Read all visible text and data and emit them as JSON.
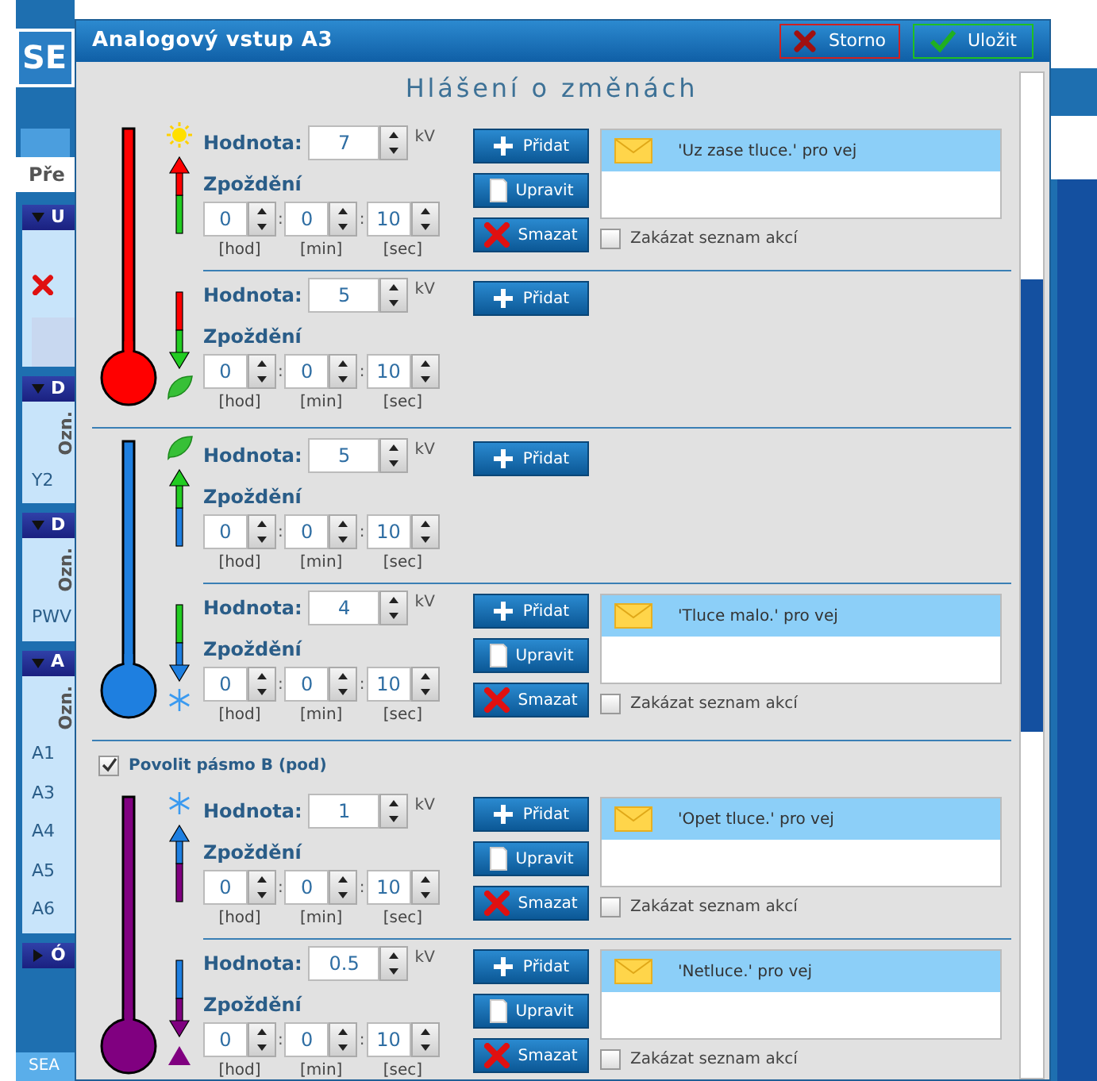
{
  "background_app": {
    "logo": "SE",
    "tab_label": "Pře",
    "panels": [
      {
        "header": "U",
        "expanded": true,
        "kind": "status"
      },
      {
        "header": "D",
        "expanded": true,
        "kind": "table",
        "column": "Ozn.",
        "rows": [
          "Y2"
        ]
      },
      {
        "header": "D",
        "expanded": true,
        "kind": "table",
        "column": "Ozn.",
        "rows": [
          "PWV"
        ]
      },
      {
        "header": "A",
        "expanded": true,
        "kind": "table",
        "column": "Ozn.",
        "rows": [
          "A1",
          "A3",
          "A4",
          "A5",
          "A6"
        ]
      },
      {
        "header": "Ó",
        "expanded": false
      }
    ],
    "footer": "SEA"
  },
  "dialog": {
    "title": "Analogový vstup A3",
    "buttons": [
      {
        "label": "Storno",
        "kind": "cancel"
      },
      {
        "label": "Uložit",
        "kind": "save"
      }
    ],
    "heading": "Hlášení o změnách"
  },
  "bands": [
    {
      "color": "#ff0000",
      "thresholds": [
        {
          "kind": "sun",
          "arrow": {
            "kind": "up",
            "segments": [
              {
                "color": "#22cc22"
              },
              {
                "color": "#ff0000"
              }
            ]
          },
          "value_label": "Hodnota:",
          "value": "7",
          "unit": "kV",
          "delay": {
            "label": "Zpoždění",
            "separator": ":",
            "fields": [
              {
                "value": "0",
                "unit": "[hod]"
              },
              {
                "value": "0",
                "unit": "[min]"
              },
              {
                "value": "10",
                "unit": "[sec]"
              }
            ]
          },
          "buttons": [
            {
              "label": "Přidat",
              "kind": "add"
            },
            {
              "label": "Upravit",
              "kind": "edit"
            },
            {
              "label": "Smazat",
              "kind": "delete"
            }
          ],
          "actions": [
            {
              "text": "'Uz zase tluce.' pro vej",
              "selected": true
            }
          ],
          "disable_actions": {
            "label": "Zakázat seznam akcí",
            "checked": false
          }
        },
        {
          "kind": "leaf",
          "arrow": {
            "kind": "down",
            "segments": [
              {
                "color": "#ff0000"
              },
              {
                "color": "#22cc22"
              }
            ]
          },
          "value_label": "Hodnota:",
          "value": "5",
          "unit": "kV",
          "delay": {
            "label": "Zpoždění",
            "separator": ":",
            "fields": [
              {
                "value": "0",
                "unit": "[hod]"
              },
              {
                "value": "0",
                "unit": "[min]"
              },
              {
                "value": "10",
                "unit": "[sec]"
              }
            ]
          },
          "buttons": [
            {
              "label": "Přidat",
              "kind": "add"
            }
          ]
        }
      ]
    },
    {
      "color": "#1e7fe0",
      "thresholds": [
        {
          "kind": "leaf",
          "arrow": {
            "kind": "up",
            "segments": [
              {
                "color": "#1e7fe0"
              },
              {
                "color": "#22cc22"
              }
            ]
          },
          "value_label": "Hodnota:",
          "value": "5",
          "unit": "kV",
          "delay": {
            "label": "Zpoždění",
            "separator": ":",
            "fields": [
              {
                "value": "0",
                "unit": "[hod]"
              },
              {
                "value": "0",
                "unit": "[min]"
              },
              {
                "value": "10",
                "unit": "[sec]"
              }
            ]
          },
          "buttons": [
            {
              "label": "Přidat",
              "kind": "add"
            }
          ]
        },
        {
          "kind": "snowflake",
          "arrow": {
            "kind": "down",
            "segments": [
              {
                "color": "#22cc22"
              },
              {
                "color": "#1e7fe0"
              }
            ]
          },
          "value_label": "Hodnota:",
          "value": "4",
          "unit": "kV",
          "delay": {
            "label": "Zpoždění",
            "separator": ":",
            "fields": [
              {
                "value": "0",
                "unit": "[hod]"
              },
              {
                "value": "0",
                "unit": "[min]"
              },
              {
                "value": "10",
                "unit": "[sec]"
              }
            ]
          },
          "buttons": [
            {
              "label": "Přidat",
              "kind": "add"
            },
            {
              "label": "Upravit",
              "kind": "edit"
            },
            {
              "label": "Smazat",
              "kind": "delete"
            }
          ],
          "actions": [
            {
              "text": "'Tluce malo.' pro vej",
              "selected": true
            }
          ],
          "disable_actions": {
            "label": "Zakázat seznam akcí",
            "checked": false
          }
        }
      ]
    },
    {
      "color": "#800080",
      "enable": {
        "label": "Povolit pásmo B (pod)",
        "checked": true
      },
      "thresholds": [
        {
          "kind": "snowflake",
          "arrow": {
            "kind": "up",
            "segments": [
              {
                "color": "#800080"
              },
              {
                "color": "#1e7fe0"
              }
            ]
          },
          "value_label": "Hodnota:",
          "value": "1",
          "unit": "kV",
          "delay": {
            "label": "Zpoždění",
            "separator": ":",
            "fields": [
              {
                "value": "0",
                "unit": "[hod]"
              },
              {
                "value": "0",
                "unit": "[min]"
              },
              {
                "value": "10",
                "unit": "[sec]"
              }
            ]
          },
          "buttons": [
            {
              "label": "Přidat",
              "kind": "add"
            },
            {
              "label": "Upravit",
              "kind": "edit"
            },
            {
              "label": "Smazat",
              "kind": "delete"
            }
          ],
          "actions": [
            {
              "text": "'Opet tluce.' pro vej",
              "selected": true
            }
          ],
          "disable_actions": {
            "label": "Zakázat seznam akcí",
            "checked": false
          }
        },
        {
          "kind": "triangle",
          "arrow": {
            "kind": "down",
            "segments": [
              {
                "color": "#1e7fe0"
              },
              {
                "color": "#800080"
              }
            ]
          },
          "value_label": "Hodnota:",
          "value": "0.5",
          "unit": "kV",
          "delay": {
            "label": "Zpoždění",
            "separator": ":",
            "fields": [
              {
                "value": "0",
                "unit": "[hod]"
              },
              {
                "value": "0",
                "unit": "[min]"
              },
              {
                "value": "10",
                "unit": "[sec]"
              }
            ]
          },
          "buttons": [
            {
              "label": "Přidat",
              "kind": "add"
            },
            {
              "label": "Upravit",
              "kind": "edit"
            },
            {
              "label": "Smazat",
              "kind": "delete"
            }
          ],
          "actions": [
            {
              "text": "'Netluce.' pro vej",
              "selected": true
            }
          ],
          "disable_actions": {
            "label": "Zakázat seznam akcí",
            "checked": false
          }
        }
      ]
    }
  ]
}
